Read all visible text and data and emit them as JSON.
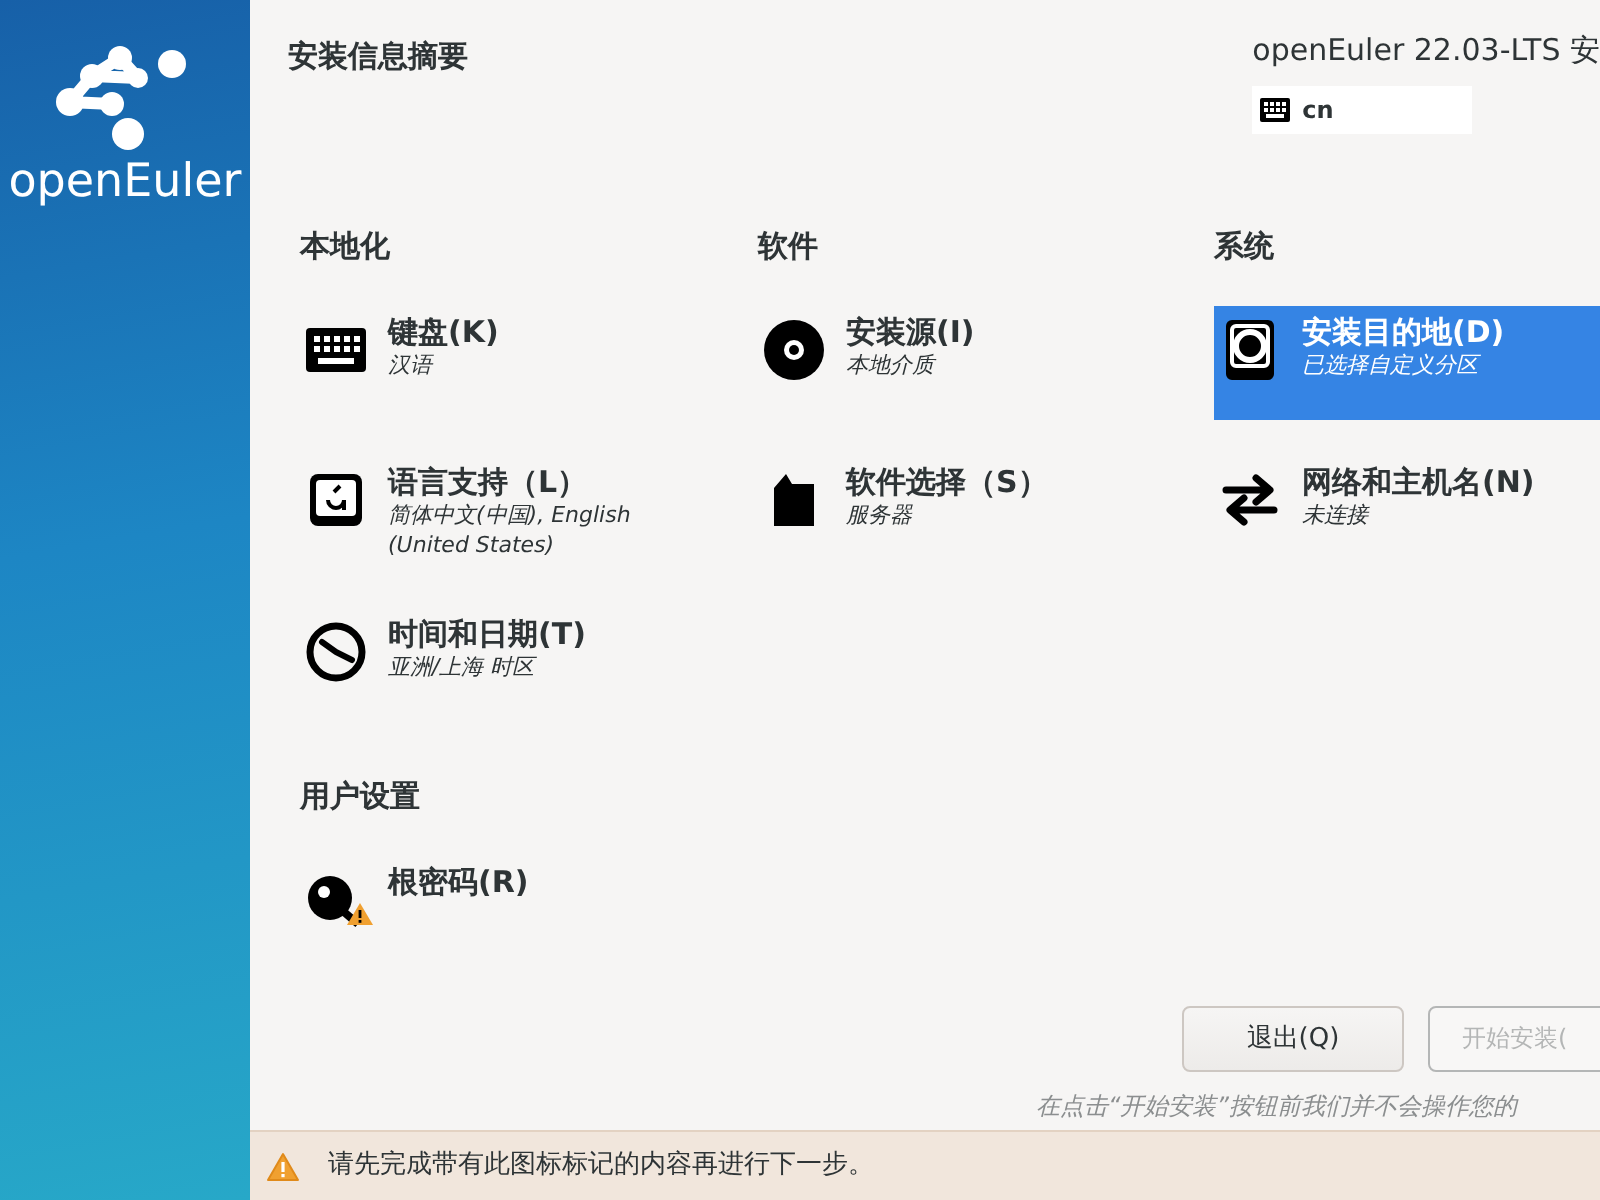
{
  "sidebar": {
    "logo_text": "openEuler"
  },
  "header": {
    "title": "安装信息摘要",
    "product": "openEuler 22.03-LTS 安",
    "keyboard_layout": "cn"
  },
  "categories": [
    {
      "title": "本地化",
      "spokes": [
        {
          "kind": "keyboard",
          "title": "键盘(K)",
          "status": "汉语",
          "selected": false,
          "warning": false
        },
        {
          "kind": "language",
          "title": "语言支持（L）",
          "status": "简体中文(中国), English (United States)",
          "selected": false,
          "warning": false
        },
        {
          "kind": "clock",
          "title": "时间和日期(T)",
          "status": "亚洲/上海 时区",
          "selected": false,
          "warning": false
        }
      ]
    },
    {
      "title": "软件",
      "spokes": [
        {
          "kind": "disc",
          "title": "安装源(I)",
          "status": "本地介质",
          "selected": false,
          "warning": false
        },
        {
          "kind": "package",
          "title": "软件选择（S）",
          "status": "服务器",
          "selected": false,
          "warning": false
        }
      ]
    },
    {
      "title": "系统",
      "spokes": [
        {
          "kind": "disk",
          "title": "安装目的地(D)",
          "status": "已选择自定义分区",
          "selected": true,
          "warning": false
        },
        {
          "kind": "network",
          "title": "网络和主机名(N)",
          "status": "未连接",
          "selected": false,
          "warning": false
        }
      ]
    },
    {
      "title": "用户设置",
      "spokes": [
        {
          "kind": "key",
          "title": "根密码(R)",
          "selected": false,
          "warning": true
        }
      ]
    }
  ],
  "buttons": [
    {
      "label": "退出(Q)",
      "disabled": false
    },
    {
      "label": "开始安装(",
      "disabled": true
    }
  ],
  "hint": "在点击“开始安装”按钮前我们并不会操作您的",
  "warning_bar": {
    "text": "请先完成带有此图标标记的内容再进行下一步。"
  }
}
